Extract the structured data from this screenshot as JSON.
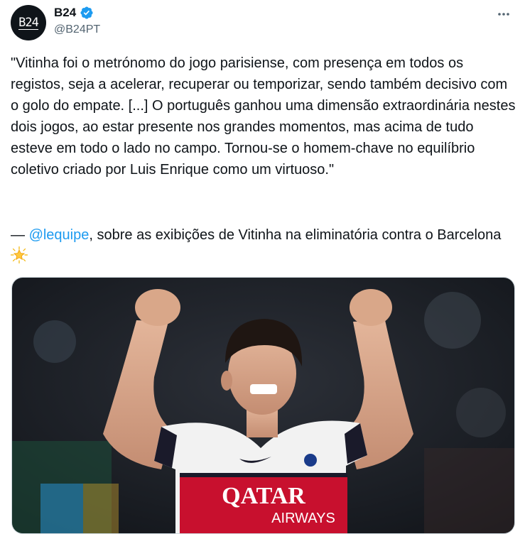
{
  "author": {
    "avatar_text": "B24",
    "display_name": "B24",
    "handle": "@B24PT"
  },
  "tweet": {
    "quote": "\"Vitinha foi o metrónomo do jogo parisiense, com presença em todos os registos, seja a acelerar, recuperar ou temporizar, sendo também decisivo com o golo do empate. [...] O português ganhou uma dimensão extraordinária nestes dois jogos, ao estar presente nos grandes momentos, mas acima de tudo esteve em todo o lado no campo. Tornou-se o homem-chave no equilíbrio coletivo criado por Luis Enrique como um virtuoso.\"",
    "attribution_prefix": "— ",
    "mention": "@lequipe",
    "attribution_suffix": ", sobre as exibições de Vitinha na eliminatória contra o Barcelona "
  },
  "media": {
    "sponsor_line1": "QATAR",
    "sponsor_line2": "AIRWAYS"
  },
  "icons": {
    "verified": "verified-badge-icon",
    "more": "more-options-icon",
    "star": "glowing-star-icon"
  },
  "colors": {
    "accent": "#1d9bf0",
    "text": "#0f1419",
    "secondary": "#536471"
  }
}
